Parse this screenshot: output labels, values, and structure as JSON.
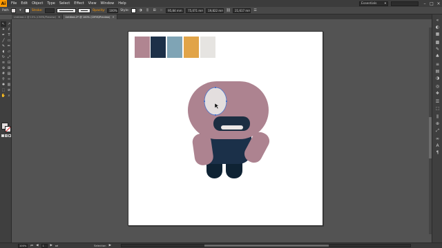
{
  "app": {
    "logo_text": "Ai"
  },
  "menu": {
    "items": [
      "File",
      "Edit",
      "Object",
      "Type",
      "Select",
      "Effect",
      "View",
      "Window",
      "Help"
    ]
  },
  "workspace": {
    "label": "Essentials",
    "arrow": "▾"
  },
  "window_controls": {
    "minimize": "–",
    "maximize": "□",
    "close": "×"
  },
  "control_bar": {
    "selection_label": "Path",
    "stroke_label": "Stroke:",
    "opacity_label": "Opacity:",
    "opacity_value": "100%",
    "style_label": "Style:",
    "x_value": "95,84 mm",
    "y_value": "75,071 mm",
    "w_value": "19,822 mm",
    "h_value": "21,617 mm",
    "colors": {
      "fill": "#e3dede",
      "accent": "#ff9a00"
    }
  },
  "tabs": [
    {
      "label": "Untitled-1 @ 15% (CMYK/Preview)",
      "close": "×",
      "active": false
    },
    {
      "label": "Untitled-2* @ 100% (CMYK/Preview)",
      "close": "×",
      "active": true
    }
  ],
  "tools": [
    {
      "name": "selection-tool-icon",
      "glyph": "↖"
    },
    {
      "name": "direct-selection-tool-icon",
      "glyph": "↗"
    },
    {
      "name": "magic-wand-tool-icon",
      "glyph": "✦"
    },
    {
      "name": "lasso-tool-icon",
      "glyph": "ℓ"
    },
    {
      "name": "pen-tool-icon",
      "glyph": "✒"
    },
    {
      "name": "type-tool-icon",
      "glyph": "T"
    },
    {
      "name": "line-tool-icon",
      "glyph": "╱"
    },
    {
      "name": "rectangle-tool-icon",
      "glyph": "▭"
    },
    {
      "name": "paintbrush-tool-icon",
      "glyph": "✎"
    },
    {
      "name": "pencil-tool-icon",
      "glyph": "✏"
    },
    {
      "name": "blob-brush-tool-icon",
      "glyph": "◖"
    },
    {
      "name": "eraser-tool-icon",
      "glyph": "▱"
    },
    {
      "name": "rotate-tool-icon",
      "glyph": "↻"
    },
    {
      "name": "scale-tool-icon",
      "glyph": "⤢"
    },
    {
      "name": "width-tool-icon",
      "glyph": "≋"
    },
    {
      "name": "free-transform-tool-icon",
      "glyph": "⊡"
    },
    {
      "name": "shape-builder-tool-icon",
      "glyph": "⊕"
    },
    {
      "name": "perspective-grid-tool-icon",
      "glyph": "⊞"
    },
    {
      "name": "mesh-tool-icon",
      "glyph": "#"
    },
    {
      "name": "gradient-tool-icon",
      "glyph": "▤"
    },
    {
      "name": "eyedropper-tool-icon",
      "glyph": "⚲"
    },
    {
      "name": "blend-tool-icon",
      "glyph": "∞"
    },
    {
      "name": "symbol-sprayer-tool-icon",
      "glyph": "✺"
    },
    {
      "name": "graph-tool-icon",
      "glyph": "▥"
    },
    {
      "name": "artboard-tool-icon",
      "glyph": "⬚"
    },
    {
      "name": "slice-tool-icon",
      "glyph": "⧄"
    },
    {
      "name": "hand-tool-icon",
      "glyph": "✋"
    },
    {
      "name": "zoom-tool-icon",
      "glyph": "⌕"
    }
  ],
  "dock_icons": [
    {
      "name": "collapse-panels-icon",
      "glyph": "«"
    },
    {
      "name": "color-panel-icon",
      "glyph": "◐"
    },
    {
      "name": "color-guide-panel-icon",
      "glyph": "▦"
    },
    {
      "name": "swatches-panel-icon",
      "glyph": "▩"
    },
    {
      "name": "brushes-panel-icon",
      "glyph": "✎"
    },
    {
      "name": "symbols-panel-icon",
      "glyph": "♣"
    },
    {
      "name": "stroke-panel-icon",
      "glyph": "≡"
    },
    {
      "name": "gradient-panel-icon",
      "glyph": "▤"
    },
    {
      "name": "transparency-panel-icon",
      "glyph": "◑"
    },
    {
      "name": "appearance-panel-icon",
      "glyph": "◎"
    },
    {
      "name": "graphic-styles-panel-icon",
      "glyph": "❖"
    },
    {
      "name": "layers-panel-icon",
      "glyph": "☰"
    },
    {
      "name": "artboards-panel-icon",
      "glyph": "⬚"
    },
    {
      "name": "align-panel-icon",
      "glyph": "⫼"
    },
    {
      "name": "pathfinder-panel-icon",
      "glyph": "⊕"
    },
    {
      "name": "transform-panel-icon",
      "glyph": "⤢"
    },
    {
      "name": "links-panel-icon",
      "glyph": "∞"
    },
    {
      "name": "character-panel-icon",
      "glyph": "A"
    },
    {
      "name": "paragraph-panel-icon",
      "glyph": "¶"
    }
  ],
  "palette": [
    "#b08591",
    "#1d3048",
    "#7fa4b5",
    "#e1a448",
    "#e6e4e1"
  ],
  "character": {
    "head": "#ad8390",
    "body": "#1b3049",
    "legs": "#0f2334",
    "eye": "#e3dede",
    "mouth": "#1c2e42",
    "teeth": "#ece8e6",
    "selection": "#4a72c8"
  },
  "status_bar": {
    "zoom": "100%",
    "artboard_number": "1",
    "tool_label": "Selection",
    "first_icon": "⏮",
    "prev_icon": "◀",
    "next_icon": "▶",
    "last_icon": "⏭",
    "menu_arrow": "▶"
  }
}
